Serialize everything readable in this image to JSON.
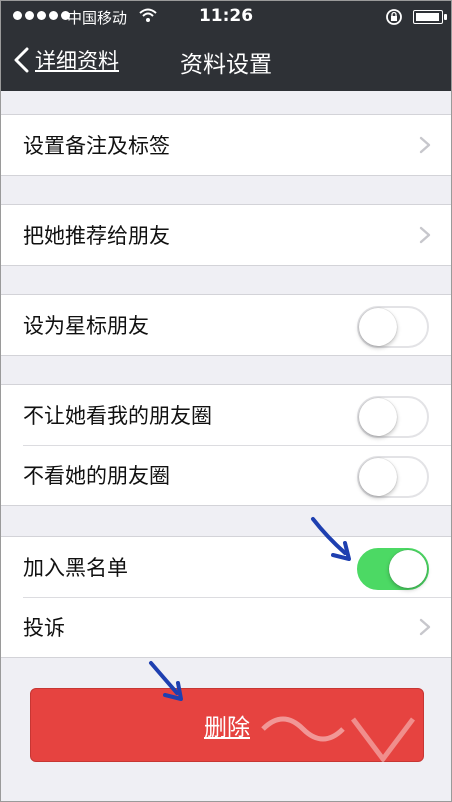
{
  "status_bar": {
    "carrier": "中国移动",
    "time": "11:26"
  },
  "nav": {
    "back_label": "详细资料",
    "title": "资料设置"
  },
  "groups": [
    {
      "items": [
        {
          "label": "设置备注及标签",
          "control": "chevron"
        }
      ]
    },
    {
      "items": [
        {
          "label": "把她推荐给朋友",
          "control": "chevron"
        }
      ]
    },
    {
      "items": [
        {
          "label": "设为星标朋友",
          "control": "switch",
          "on": false
        }
      ]
    },
    {
      "items": [
        {
          "label": "不让她看我的朋友圈",
          "control": "switch",
          "on": false
        },
        {
          "label": "不看她的朋友圈",
          "control": "switch",
          "on": false
        }
      ]
    },
    {
      "items": [
        {
          "label": "加入黑名单",
          "control": "switch",
          "on": true
        },
        {
          "label": "投诉",
          "control": "chevron"
        }
      ]
    }
  ],
  "delete_button": {
    "label": "删除"
  },
  "colors": {
    "nav_bg": "#2e3136",
    "page_bg": "#efeff4",
    "switch_on": "#4cd964",
    "delete_red": "#e64340",
    "annotation_arrow": "#1e3fb0"
  }
}
